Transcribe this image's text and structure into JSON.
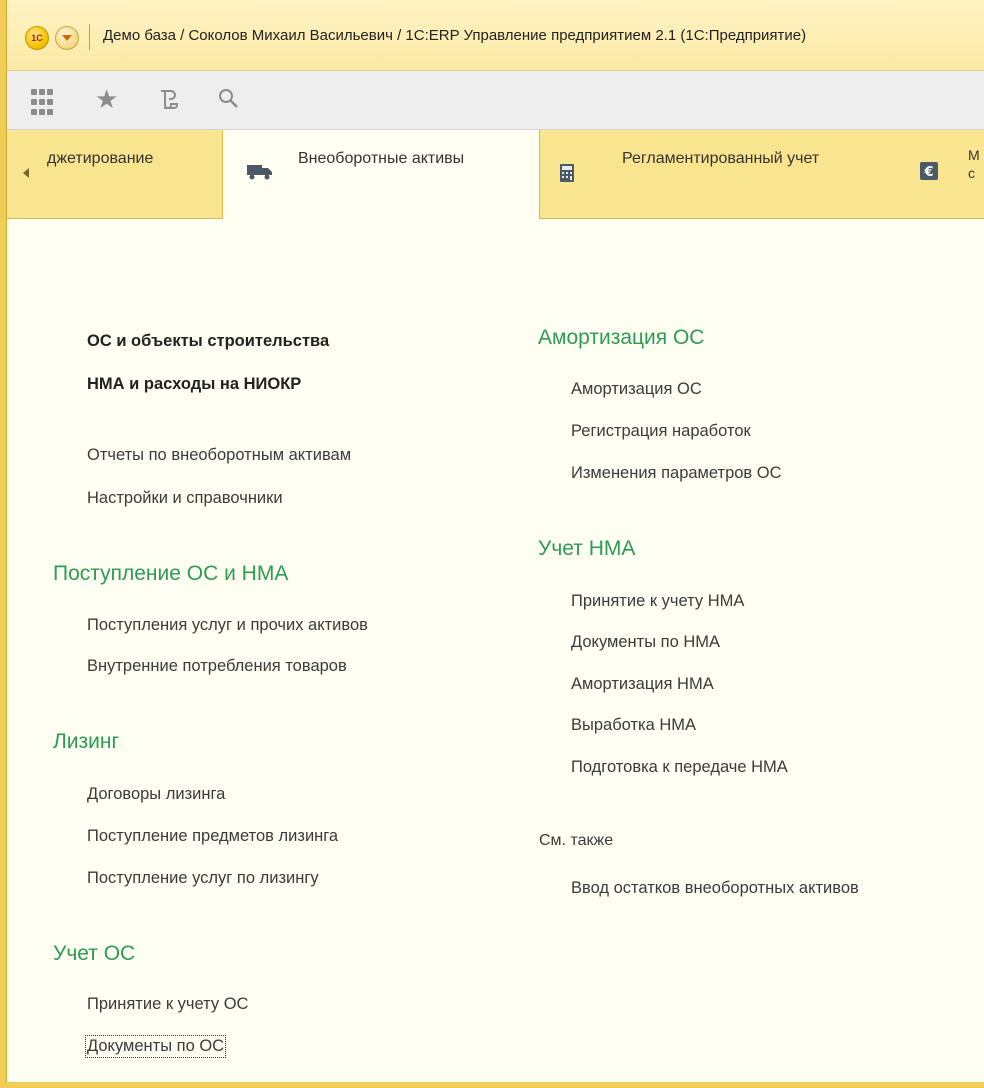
{
  "window": {
    "title": "Демо база / Соколов Михаил Васильевич / 1С:ERP Управление предприятием 2.1  (1С:Предприятие)",
    "logo_text": "1С"
  },
  "toolbar": {
    "icons": [
      "apps-grid-icon",
      "star-icon",
      "history-icon",
      "search-icon"
    ]
  },
  "tabs": [
    {
      "label": "джетирование",
      "icon": "none"
    },
    {
      "label": "Внеоборотные активы",
      "icon": "truck-icon",
      "active": true
    },
    {
      "label": "Регламентированный учет",
      "icon": "calculator-icon"
    },
    {
      "label": "М\nс",
      "icon": "euro-icon"
    }
  ],
  "left_column": {
    "main_links": [
      "ОС и объекты строительства",
      "НМА и расходы на НИОКР"
    ],
    "reports_links": [
      "Отчеты по внеоборотным активам",
      "Настройки и справочники"
    ],
    "groups": [
      {
        "title": "Поступление ОС и НМА",
        "items": [
          "Поступления услуг и прочих активов",
          "Внутренние потребления товаров"
        ]
      },
      {
        "title": "Лизинг",
        "items": [
          "Договоры лизинга",
          "Поступление предметов лизинга",
          "Поступление услуг по лизингу"
        ]
      },
      {
        "title": "Учет ОС",
        "items": [
          "Принятие к учету ОС",
          "Документы по ОС"
        ]
      }
    ]
  },
  "right_column": {
    "groups": [
      {
        "title": "Амортизация ОС",
        "items": [
          "Амортизация ОС",
          "Регистрация наработок",
          "Изменения параметров ОС"
        ]
      },
      {
        "title": "Учет НМА",
        "items": [
          "Принятие к учету НМА",
          "Документы по НМА",
          "Амортизация НМА",
          "Выработка НМА",
          "Подготовка к передаче НМА"
        ]
      }
    ],
    "see_also": {
      "title": "См. также",
      "items": [
        "Ввод остатков внеоборотных активов"
      ]
    }
  },
  "colors": {
    "group_title": "#2e9b55",
    "tab_bar": "#f9e58f",
    "content_bg": "#fefef2"
  }
}
